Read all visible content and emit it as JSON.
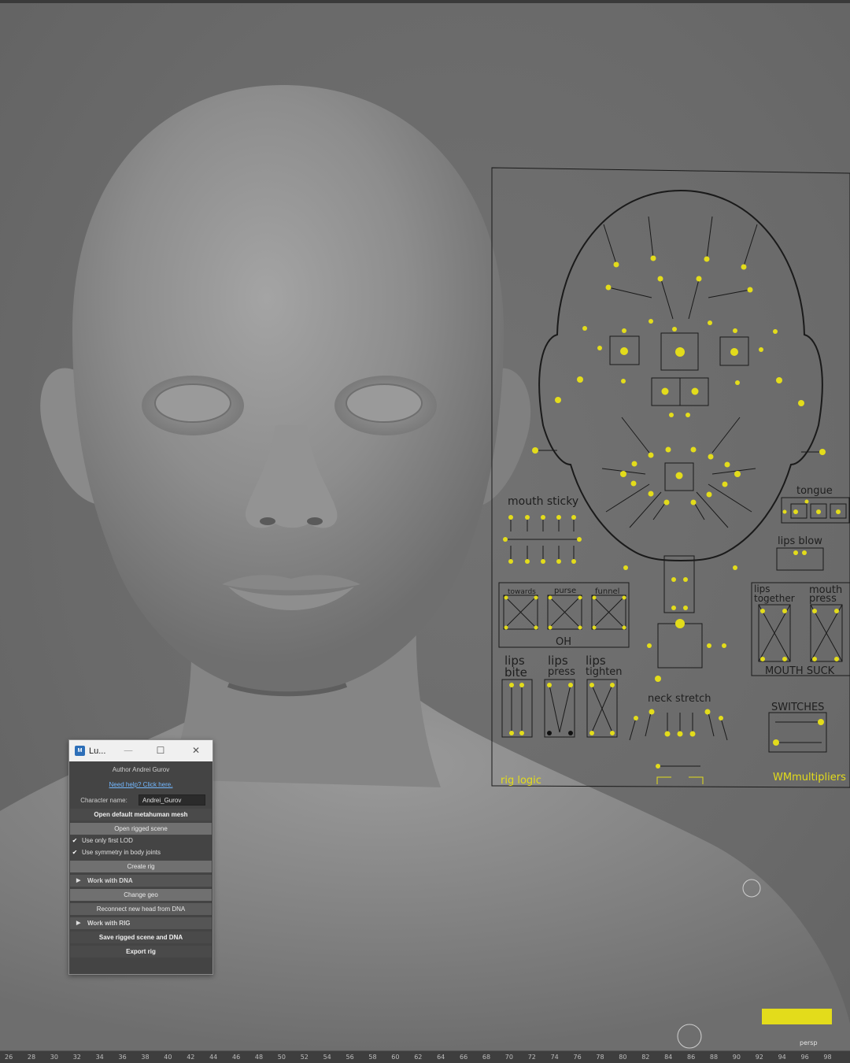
{
  "window": {
    "title": "Lu...",
    "app_icon_label": "M",
    "minimize": "—",
    "maximize": "☐",
    "close": "✕"
  },
  "panel": {
    "author": "Author Andrei Gurov",
    "help_link": "Need help? Click here.",
    "character_name_label": "Character name:",
    "character_name_value": "Andrei_Gurov",
    "open_default_button": "Open default metahuman mesh",
    "open_rigged_button": "Open rigged scene",
    "only_first_lod_label": "Use only first LOD",
    "symmetry_label": "Use symmetry in body joints",
    "create_rig_button": "Create rig",
    "work_dna_section": "Work with DNA",
    "change_geo_button": "Change geo",
    "reconnect_button": "Reconnect new head from DNA",
    "work_rig_section": "Work with RIG",
    "save_button": "Save rigged scene and DNA",
    "export_button": "Export rig"
  },
  "rig_board": {
    "mouth_sticky": "mouth sticky",
    "tongue": "tongue",
    "lips_blow": "lips blow",
    "towards": "towards",
    "purse": "purse",
    "funnel": "funnel",
    "oh": "OH",
    "lips_together_1": "lips",
    "lips_together_2": "together",
    "mouth_press_1": "mouth",
    "mouth_press_2": "press",
    "mouth_suck": "MOUTH SUCK",
    "lips_bite_1": "lips",
    "lips_bite_2": "bite",
    "lips_press_1": "lips",
    "lips_press_2": "press",
    "lips_tighten_1": "lips",
    "lips_tighten_2": "tighten",
    "neck_stretch": "neck stretch",
    "switches": "SWITCHES",
    "rig_logic": "rig logic",
    "wm_multipliers": "WMmultipliers"
  },
  "viewport": {
    "camera_label": "persp"
  },
  "timeline_ticks": [
    "26",
    "28",
    "30",
    "32",
    "34",
    "36",
    "38",
    "40",
    "42",
    "44",
    "46",
    "48",
    "50",
    "52",
    "54",
    "56",
    "58",
    "60",
    "62",
    "64",
    "66",
    "68",
    "70",
    "72",
    "74",
    "76",
    "78",
    "80",
    "82",
    "84",
    "86",
    "88",
    "90",
    "92",
    "94",
    "96",
    "98"
  ],
  "colors": {
    "control_yellow": "#e3dc1b",
    "link_blue": "#73b8ff",
    "panel_bg": "#444444"
  }
}
